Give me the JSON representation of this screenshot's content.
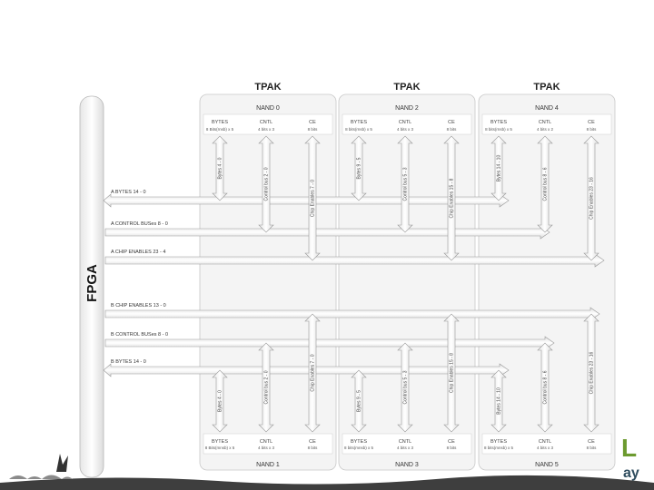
{
  "fpga": "FPGA",
  "tpaks": [
    {
      "label": "TPAK",
      "top": "NAND 0",
      "bottom": "NAND 1"
    },
    {
      "label": "TPAK",
      "top": "NAND 2",
      "bottom": "NAND 3"
    },
    {
      "label": "TPAK",
      "top": "NAND 4",
      "bottom": "NAND 5"
    }
  ],
  "cell_headers": {
    "top": [
      [
        "BYTES",
        "CNTL",
        "CE"
      ],
      [
        "BYTES",
        "CNTL",
        "CE"
      ],
      [
        "BYTES",
        "CNTL",
        "CE"
      ]
    ],
    "top_sub": [
      [
        "8 Bits(rnsb) x 5",
        "4 bits x 3",
        "8 bits"
      ],
      [
        "8 bits(rnsb) x 5",
        "4 bits x 3",
        "8 bits"
      ],
      [
        "8 bits(rnsb) x 5",
        "4 bits x 2",
        "8 bits"
      ]
    ],
    "bottom": [
      [
        "BYTES",
        "CNTL",
        "CE"
      ],
      [
        "BYTES",
        "CNTL",
        "CE"
      ],
      [
        "BYTES",
        "CNTL",
        "CE"
      ]
    ],
    "bottom_sub": [
      [
        "8 Bits(mnsb) x 5",
        "4 bits x 3",
        "8 bits"
      ],
      [
        "8 bits(mnsb) x 5",
        "4 bits x 3",
        "8 bits"
      ],
      [
        "8 bits(mnsb) x 5",
        "4 bits x 3",
        "8 bits"
      ]
    ]
  },
  "buses": [
    "A BYTES 14 - 0",
    "A CONTROL BUSes 8 - 0",
    "A CHIP ENABLES 23 - 4",
    "B CHIP ENABLES 13 - 0",
    "B CONTROL BUSes 8 - 0",
    "B BYTES 14 - 0"
  ],
  "vertical_top": [
    [
      "Bytes 4 - 0",
      "Control bus 2 - 0",
      "Chip Enables 7 - 0"
    ],
    [
      "Bytes 9 - 5",
      "Control bus 5 - 3",
      "Chip Enables 15 - 8"
    ],
    [
      "Bytes 14 - 10",
      "Control bus 8 - 6",
      "Chip Enables 23 - 16"
    ]
  ],
  "vertical_bottom": [
    [
      "Bytes 4 - 0",
      "Control bus 2 - 0",
      "Chip Enables 7 - 0"
    ],
    [
      "Bytes 9 - 5",
      "Control bus 5 - 3",
      "Chip Enables 15 - 8"
    ],
    [
      "Bytes 14 - 10",
      "Control bus 8 - 6",
      "Chip Enables 23 - 16"
    ]
  ],
  "logo": {
    "letter": "L",
    "text": "ay",
    "colors": {
      "green": "#6c9a2f",
      "navy": "#2f4d5f"
    }
  }
}
